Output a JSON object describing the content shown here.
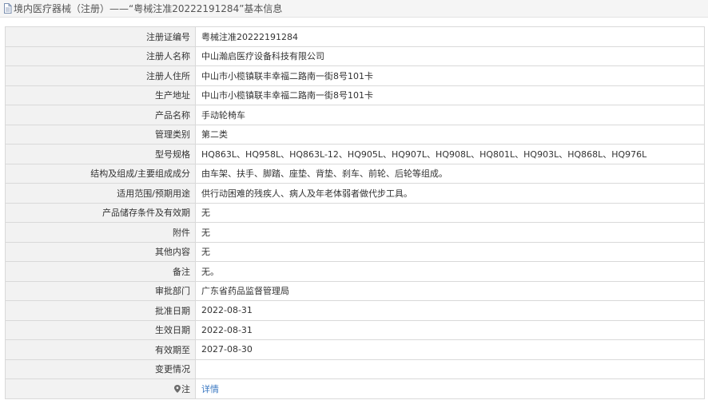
{
  "header": {
    "title": "境内医疗器械（注册）——“粤械注准20222191284”基本信息"
  },
  "rows": [
    {
      "label": "注册证编号",
      "value": "粤械注准20222191284"
    },
    {
      "label": "注册人名称",
      "value": "中山瀚启医疗设备科技有限公司"
    },
    {
      "label": "注册人住所",
      "value": "中山市小榄镇联丰幸福二路南一街8号101卡"
    },
    {
      "label": "生产地址",
      "value": "中山市小榄镇联丰幸福二路南一街8号101卡"
    },
    {
      "label": "产品名称",
      "value": "手动轮椅车"
    },
    {
      "label": "管理类别",
      "value": "第二类"
    },
    {
      "label": "型号规格",
      "value": "HQ863L、HQ958L、HQ863L-12、HQ905L、HQ907L、HQ908L、HQ801L、HQ903L、HQ868L、HQ976L"
    },
    {
      "label": "结构及组成/主要组成成分",
      "value": "由车架、扶手、脚踏、座垫、背垫、刹车、前轮、后轮等组成。"
    },
    {
      "label": "适用范围/预期用途",
      "value": "供行动困难的残疾人、病人及年老体弱者做代步工具。"
    },
    {
      "label": "产品储存条件及有效期",
      "value": "无"
    },
    {
      "label": "附件",
      "value": "无"
    },
    {
      "label": "其他内容",
      "value": "无"
    },
    {
      "label": "备注",
      "value": "无。"
    },
    {
      "label": "审批部门",
      "value": "广东省药品监督管理局"
    },
    {
      "label": "批准日期",
      "value": "2022-08-31"
    },
    {
      "label": "生效日期",
      "value": "2022-08-31"
    },
    {
      "label": "有效期至",
      "value": "2027-08-30"
    },
    {
      "label": "变更情况",
      "value": ""
    }
  ],
  "note_row": {
    "label": "注",
    "link_text": "详情",
    "icon": "map-pin-icon"
  },
  "colors": {
    "label_bg": "#f2f2f2",
    "border": "#d9d9d9",
    "link": "#3a78c2",
    "title_bg": "#f5f5f5"
  }
}
